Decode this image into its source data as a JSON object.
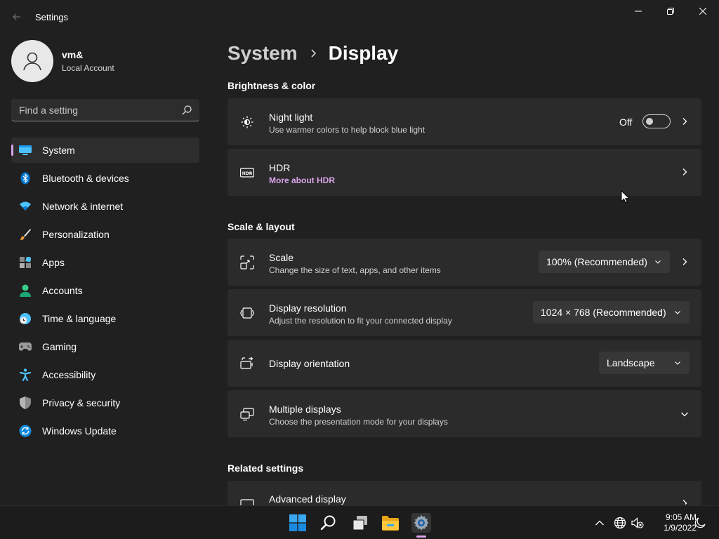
{
  "window": {
    "title": "Settings"
  },
  "profile": {
    "name": "vm&",
    "account_type": "Local Account"
  },
  "search": {
    "placeholder": "Find a setting"
  },
  "sidebar": {
    "items": [
      {
        "label": "System",
        "active": true
      },
      {
        "label": "Bluetooth & devices"
      },
      {
        "label": "Network & internet"
      },
      {
        "label": "Personalization"
      },
      {
        "label": "Apps"
      },
      {
        "label": "Accounts"
      },
      {
        "label": "Time & language"
      },
      {
        "label": "Gaming"
      },
      {
        "label": "Accessibility"
      },
      {
        "label": "Privacy & security"
      },
      {
        "label": "Windows Update"
      }
    ]
  },
  "breadcrumb": {
    "parent": "System",
    "current": "Display"
  },
  "sections": {
    "brightness": "Brightness & color",
    "scale_layout": "Scale & layout",
    "related": "Related settings"
  },
  "cards": {
    "night_light": {
      "title": "Night light",
      "subtitle": "Use warmer colors to help block blue light",
      "toggle_state": "Off"
    },
    "hdr": {
      "title": "HDR",
      "subtitle": "More about HDR"
    },
    "scale": {
      "title": "Scale",
      "subtitle": "Change the size of text, apps, and other items",
      "value": "100% (Recommended)"
    },
    "resolution": {
      "title": "Display resolution",
      "subtitle": "Adjust the resolution to fit your connected display",
      "value": "1024 × 768 (Recommended)"
    },
    "orientation": {
      "title": "Display orientation",
      "value": "Landscape"
    },
    "multiple": {
      "title": "Multiple displays",
      "subtitle": "Choose the presentation mode for your displays"
    },
    "advanced": {
      "title": "Advanced display"
    }
  },
  "taskbar": {
    "time": "9:05 AM",
    "date": "1/9/2022"
  },
  "colors": {
    "accent": "#d8a3e8",
    "background": "#202020",
    "card": "#2b2b2b"
  }
}
